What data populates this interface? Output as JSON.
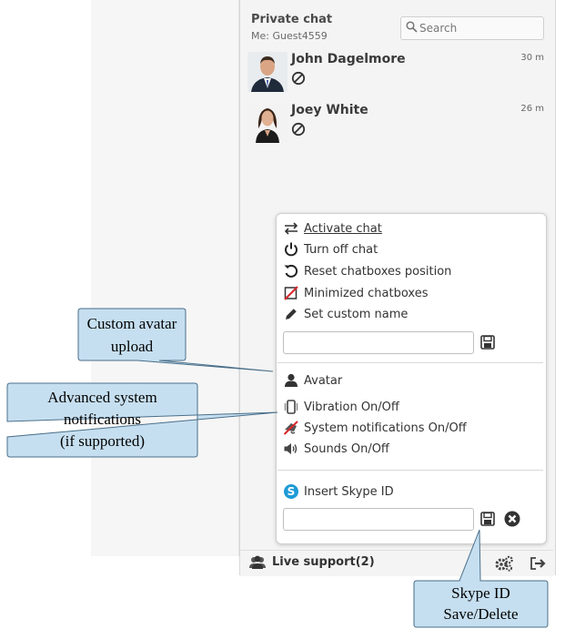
{
  "header": {
    "title": "Private chat",
    "me": "Me: Guest4559",
    "search_placeholder": "Search"
  },
  "contacts": [
    {
      "name": "John Dagelmore",
      "time": "30 m"
    },
    {
      "name": "Joey White",
      "time": "26 m"
    }
  ],
  "menu": {
    "activate": "Activate chat",
    "turn_off": "Turn off chat",
    "reset": "Reset chatboxes position",
    "minimized": "Minimized chatboxes",
    "custom_name": "Set custom name",
    "avatar": "Avatar",
    "vibration": "Vibration On/Off",
    "system": "System notifications On/Off",
    "sounds": "Sounds On/Off",
    "skype": "Insert Skype ID"
  },
  "footer": {
    "label": "Live support(2)"
  },
  "callouts": {
    "avatar_l1": "Custom avatar",
    "avatar_l2": "upload",
    "notif_l1": "Advanced system",
    "notif_l2": "notifications",
    "notif_l3": "(if supported)",
    "skype_l1": "Skype ID",
    "skype_l2": "Save/Delete"
  },
  "colors": {
    "callout_fill": "#c6dff0",
    "callout_border": "#4a6f8a",
    "panel_bg": "#f4f4f4",
    "skype_blue": "#1e9bd7",
    "red_slash": "#d9262a"
  }
}
